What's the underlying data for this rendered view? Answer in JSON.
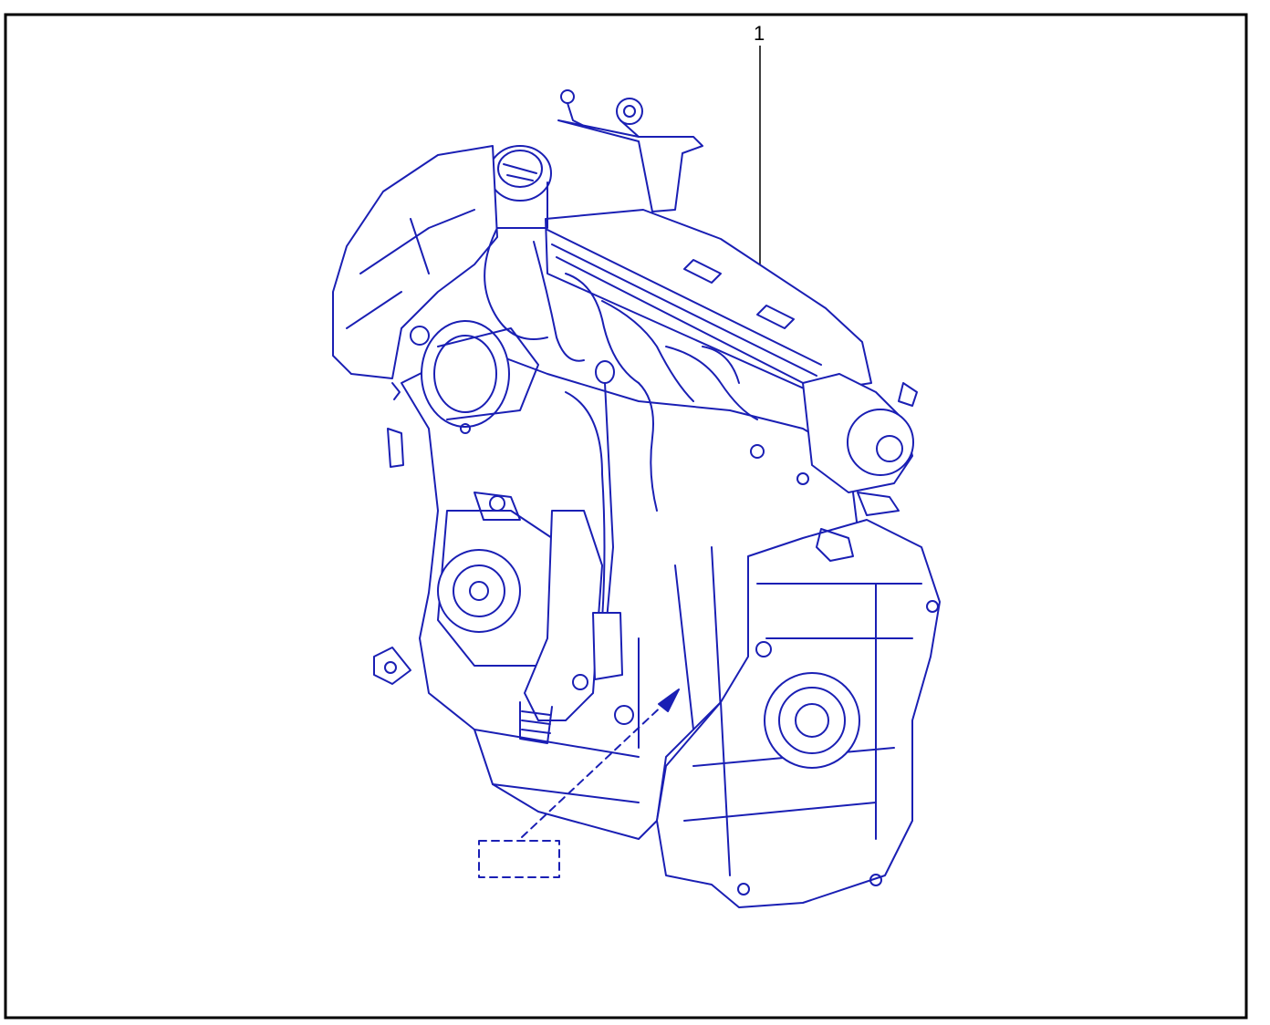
{
  "diagram": {
    "callouts": [
      {
        "id": "1",
        "label": "1"
      }
    ],
    "line_color": "#1a1fb4",
    "fill_color": "#ffffff",
    "frame_color": "#000000",
    "subject_icon": "engine-assembly-icon"
  }
}
